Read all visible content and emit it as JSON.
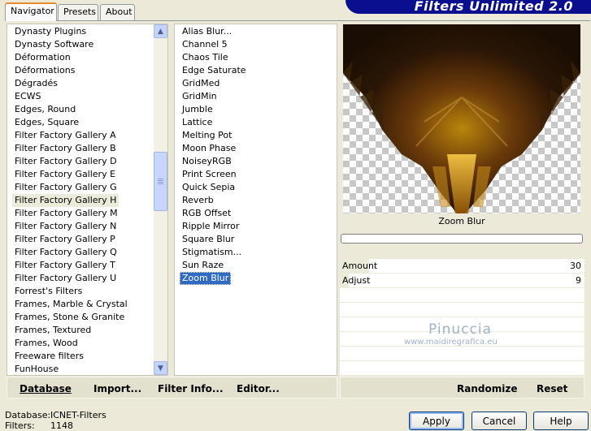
{
  "tabs": [
    "Navigator",
    "Presets",
    "About"
  ],
  "banner_title": "Filters Unlimited 2.0",
  "categories": [
    "Dynasty Plugins",
    "Dynasty Software",
    "Déformation",
    "Déformations",
    "Dégradés",
    "ECWS",
    "Edges, Round",
    "Edges, Square",
    "Filter Factory Gallery A",
    "Filter Factory Gallery B",
    "Filter Factory Gallery D",
    "Filter Factory Gallery E",
    "Filter Factory Gallery G",
    "Filter Factory Gallery H",
    "Filter Factory Gallery M",
    "Filter Factory Gallery N",
    "Filter Factory Gallery P",
    "Filter Factory Gallery Q",
    "Filter Factory Gallery T",
    "Filter Factory Gallery U",
    "Forrest's Filters",
    "Frames, Marble & Crystal",
    "Frames, Stone & Granite",
    "Frames, Textured",
    "Frames, Wood",
    "Freeware filters",
    "FunHouse"
  ],
  "selected_category": "Filter Factory Gallery H",
  "filters": [
    "Alias Blur...",
    "Channel 5",
    "Chaos Tile",
    "Edge Saturate",
    "GridMed",
    "GridMin",
    "Jumble",
    "Lattice",
    "Melting Pot",
    "Moon Phase",
    "NoiseyRGB",
    "Print Screen",
    "Quick Sepia",
    "Reverb",
    "RGB Offset",
    "Ripple Mirror",
    "Square Blur",
    "Stigmatism...",
    "Sun Raze",
    "Zoom Blur"
  ],
  "selected_filter": "Zoom Blur",
  "filter_title": "Zoom Blur",
  "params": [
    {
      "label": "Amount",
      "value": "30",
      "fraction": 0.118
    },
    {
      "label": "Adjust",
      "value": "9",
      "fraction": 0.035
    }
  ],
  "watermark": {
    "line1": "Pinuccia",
    "line2": "www.maidiregrafica.eu"
  },
  "toolbar_left": {
    "database": "Database",
    "import": "Import...",
    "filter_info": "Filter Info...",
    "editor": "Editor..."
  },
  "toolbar_right": {
    "randomize": "Randomize",
    "reset": "Reset"
  },
  "status": {
    "database_label": "Database:",
    "database_value": "ICNET-Filters",
    "filters_label": "Filters:",
    "filters_value": "1148"
  },
  "buttons": {
    "apply": "Apply",
    "cancel": "Cancel",
    "help": "Help"
  },
  "colors": {
    "selection_blue": "#316ac5",
    "tab_accent": "#e68b2c",
    "banner_blue": "#0a0f8f"
  }
}
